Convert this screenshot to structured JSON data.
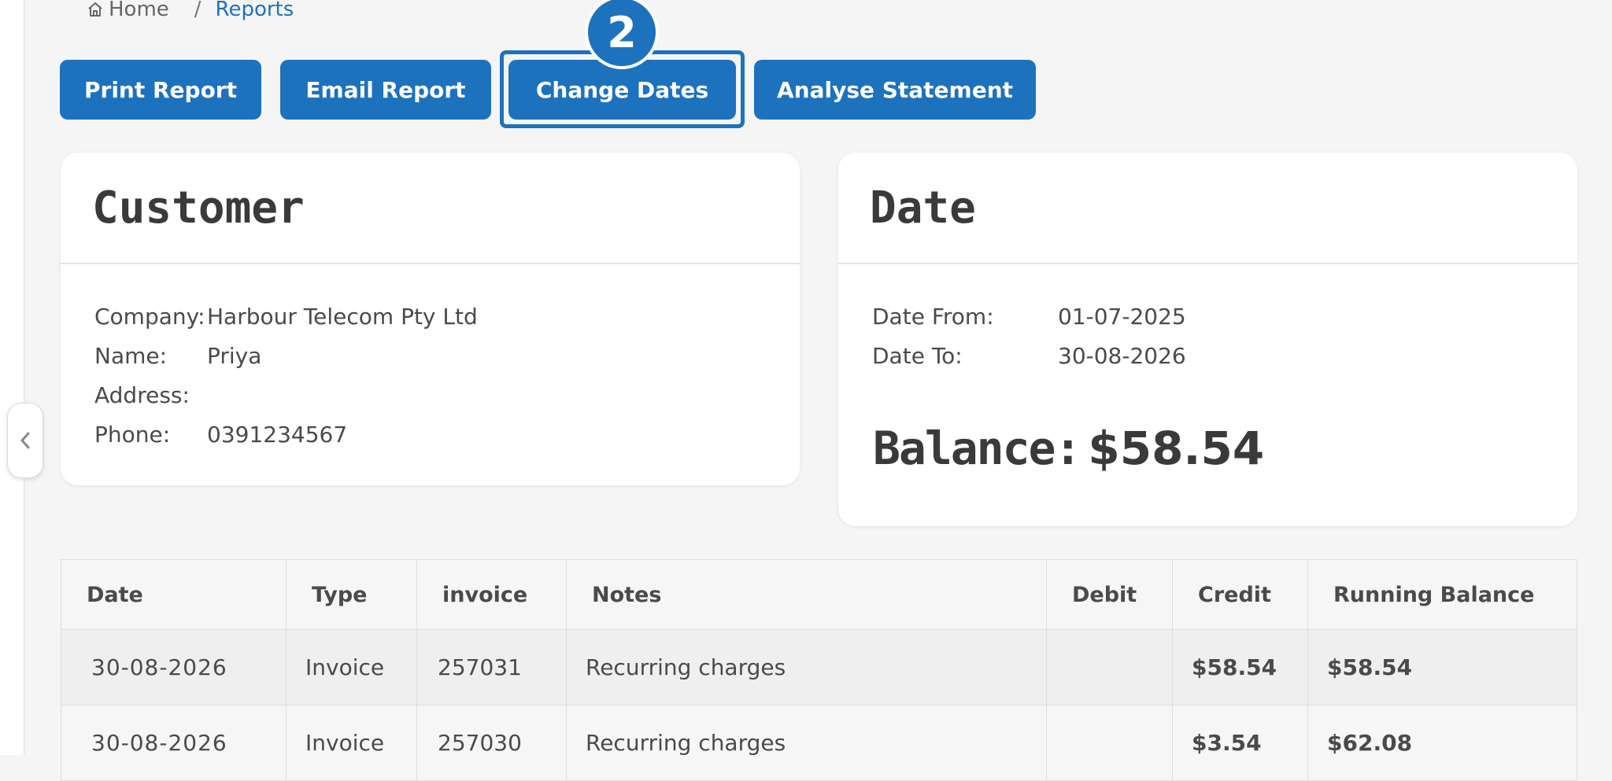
{
  "breadcrumb": {
    "home_label": "Home",
    "separator": "/",
    "current": "Reports"
  },
  "toolbar": {
    "print": "Print Report",
    "email": "Email Report",
    "change_dates": "Change Dates",
    "analyse": "Analyse Statement"
  },
  "step_badge": "2",
  "customer": {
    "title": "Customer",
    "company_label": "Company:",
    "company": "Harbour Telecom Pty Ltd",
    "name_label": "Name:",
    "name": "Priya",
    "address_label": "Address:",
    "address": "",
    "phone_label": "Phone:",
    "phone": "0391234567"
  },
  "date_card": {
    "title": "Date",
    "from_label": "Date From:",
    "from": "01-07-2025",
    "to_label": "Date To:",
    "to": "30-08-2026",
    "balance_label": "Balance:",
    "balance": "$58.54"
  },
  "table": {
    "headers": [
      "Date",
      "Type",
      "invoice",
      "Notes",
      "Debit",
      "Credit",
      "Running Balance"
    ],
    "rows": [
      {
        "date": "30-08-2026",
        "type": "Invoice",
        "invoice": "257031",
        "notes": "Recurring charges",
        "debit": "",
        "credit": "$58.54",
        "running": "$58.54"
      },
      {
        "date": "30-08-2026",
        "type": "Invoice",
        "invoice": "257030",
        "notes": "Recurring charges",
        "debit": "",
        "credit": "$3.54",
        "running": "$62.08"
      }
    ]
  },
  "colors": {
    "accent": "#1d72be",
    "credit": "#1f9a4e",
    "background": "#f5f5f5"
  },
  "icons": {
    "home": "home-icon",
    "collapse": "chevron-left-icon"
  }
}
